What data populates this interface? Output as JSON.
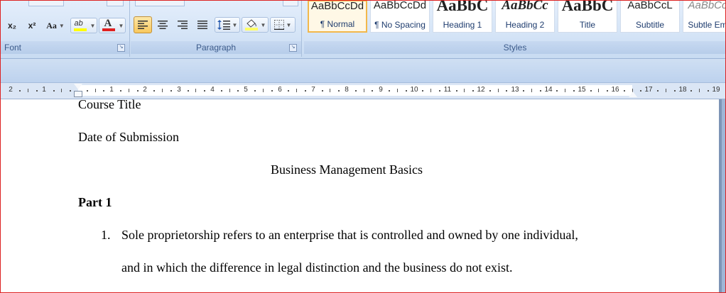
{
  "ribbon": {
    "font_group": {
      "label": "Font",
      "subscript_label": "x₂",
      "superscript_label": "x²",
      "change_case_label": "Aa",
      "highlight_label": "ab",
      "font_color_label": "A",
      "highlight_color": "#ffff00",
      "font_color": "#e02020"
    },
    "paragraph_group": {
      "label": "Paragraph"
    },
    "styles_group": {
      "label": "Styles",
      "styles": [
        {
          "sample": "AaBbCcDd",
          "name": "¶ Normal"
        },
        {
          "sample": "AaBbCcDd",
          "name": "¶ No Spacing"
        },
        {
          "sample": "AaBbC",
          "name": "Heading 1"
        },
        {
          "sample": "AaBbCc",
          "name": "Heading 2"
        },
        {
          "sample": "AaBbC",
          "name": "Title"
        },
        {
          "sample": "AaBbCcL",
          "name": "Subtitle"
        },
        {
          "sample": "AaBbCc",
          "name": "Subtle Em"
        }
      ]
    }
  },
  "ruler": {
    "left_labels": [
      "2",
      "1"
    ],
    "labels": [
      "1",
      "2",
      "3",
      "4",
      "5",
      "6",
      "7",
      "8",
      "9",
      "10",
      "11",
      "12",
      "13",
      "14",
      "15",
      "16",
      "17",
      "18",
      "19"
    ]
  },
  "document": {
    "line1": "Course Title",
    "line2": "Date of Submission",
    "title": "Business Management Basics",
    "part": "Part 1",
    "list_number": "1.",
    "list_line1": "Sole proprietorship refers to an enterprise that is controlled and owned by one individual,",
    "list_line2": "and in which the difference in legal distinction and the business do not exist."
  }
}
